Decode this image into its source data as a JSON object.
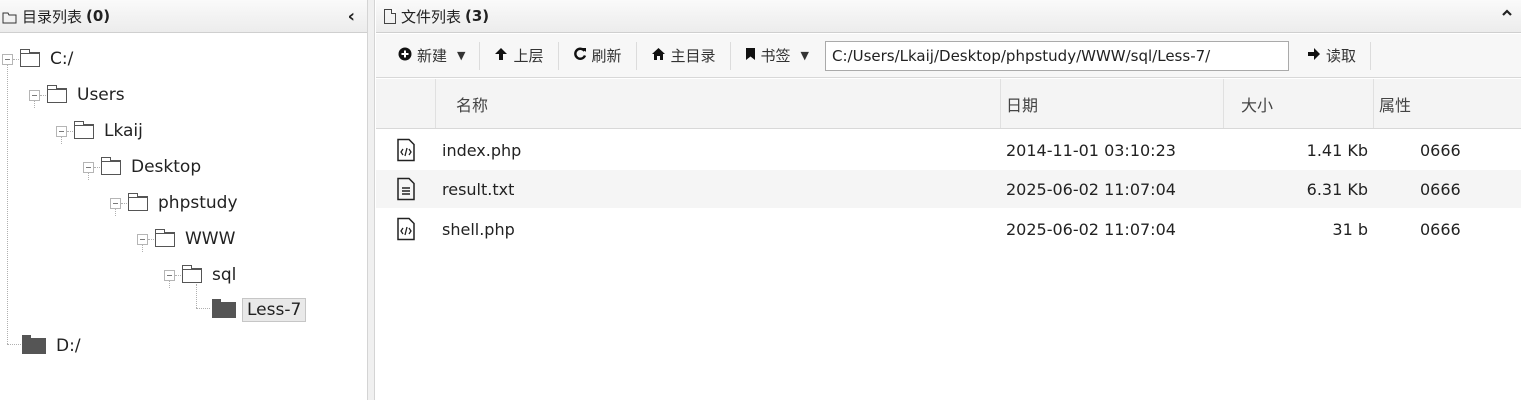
{
  "left": {
    "title": "目录列表",
    "count": "(0)",
    "collapse_glyph": "‹"
  },
  "tree": [
    {
      "label": "C:/",
      "icon": "folder-outline"
    },
    {
      "label": "Users",
      "icon": "folder-outline"
    },
    {
      "label": "Lkaij",
      "icon": "folder-outline"
    },
    {
      "label": "Desktop",
      "icon": "folder-outline"
    },
    {
      "label": "phpstudy",
      "icon": "folder-outline"
    },
    {
      "label": "WWW",
      "icon": "folder-outline"
    },
    {
      "label": "sql",
      "icon": "folder-outline"
    },
    {
      "label": "Less-7",
      "icon": "folder-solid",
      "selected": true
    },
    {
      "label": "D:/",
      "icon": "folder-solid"
    }
  ],
  "right": {
    "title": "文件列表",
    "count": "(3)",
    "caret_glyph": "⌃"
  },
  "toolbar": {
    "new_label": "新建",
    "up_label": "上层",
    "refresh_label": "刷新",
    "home_label": "主目录",
    "bookmark_label": "书签",
    "path_value": "C:/Users/Lkaij/Desktop/phpstudy/WWW/sql/Less-7/",
    "read_label": "读取"
  },
  "table": {
    "headers": {
      "name": "名称",
      "date": "日期",
      "size": "大小",
      "attr": "属性"
    },
    "rows": [
      {
        "icon": "code-file-icon",
        "name": "index.php",
        "date": "2014-11-01 03:10:23",
        "size": "1.41 Kb",
        "attr": "0666"
      },
      {
        "icon": "text-file-icon",
        "name": "result.txt",
        "date": "2025-06-02 11:07:04",
        "size": "6.31 Kb",
        "attr": "0666"
      },
      {
        "icon": "code-file-icon",
        "name": "shell.php",
        "date": "2025-06-02 11:07:04",
        "size": "31 b",
        "attr": "0666"
      }
    ]
  }
}
